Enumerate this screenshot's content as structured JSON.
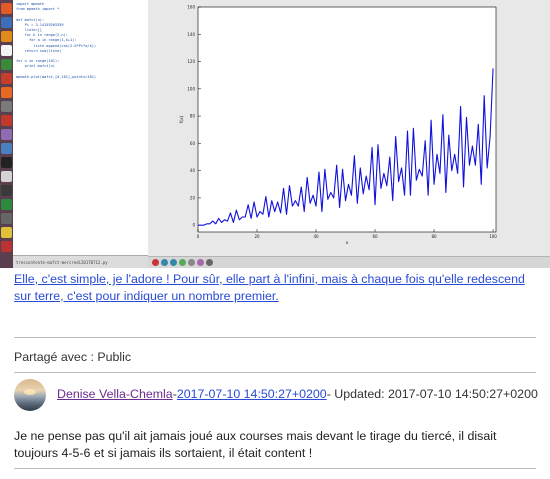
{
  "editor": {
    "code_lines": [
      "import mpmath",
      "from mpmath import *",
      "",
      "def mafct(n):",
      "    Pi = 3.14159265359",
      "    liste=[]",
      "    for k in range(2,n):",
      "      for a in range(1,k+1):",
      "        liste.append(cos(2.0*Pi*a/k))",
      "    return sum(liste)",
      "",
      "for n in range(101):",
      "    print mafct(n)",
      "",
      "mpmath.plot(mafct,[0,101],points=101)"
    ],
    "status_filename": "trescontente-mafct-mercredi20170712.py"
  },
  "plot": {
    "xlabel": "x",
    "ylabel": "f(x)"
  },
  "chart_data": {
    "type": "line",
    "xlim": [
      0,
      101
    ],
    "ylim": [
      -5,
      160
    ],
    "x_ticks": [
      "0",
      "20",
      "40",
      "60",
      "80",
      "100"
    ],
    "y_ticks": [
      "0",
      "20",
      "40",
      "60",
      "80",
      "100",
      "120",
      "140",
      "160"
    ],
    "xlabel": "x",
    "ylabel": "f(x)",
    "series": [
      {
        "color": "#1111dd",
        "x": [
          0,
          1,
          2,
          3,
          4,
          5,
          6,
          7,
          8,
          9,
          10,
          11,
          12,
          13,
          14,
          15,
          16,
          17,
          18,
          19,
          20,
          21,
          22,
          23,
          24,
          25,
          26,
          27,
          28,
          29,
          30,
          31,
          32,
          33,
          34,
          35,
          36,
          37,
          38,
          39,
          40,
          41,
          42,
          43,
          44,
          45,
          46,
          47,
          48,
          49,
          50,
          51,
          52,
          53,
          54,
          55,
          56,
          57,
          58,
          59,
          60,
          61,
          62,
          63,
          64,
          65,
          66,
          67,
          68,
          69,
          70,
          71,
          72,
          73,
          74,
          75,
          76,
          77,
          78,
          79,
          80,
          81,
          82,
          83,
          84,
          85,
          86,
          87,
          88,
          89,
          90,
          91,
          92,
          93,
          94,
          95,
          96,
          97,
          98,
          99,
          100
        ],
        "values": [
          0,
          0,
          0,
          1,
          1,
          3,
          1,
          5,
          2,
          4,
          3,
          9,
          2,
          11,
          4,
          6,
          6,
          15,
          5,
          17,
          6,
          10,
          8,
          21,
          6,
          18,
          10,
          17,
          9,
          27,
          8,
          29,
          14,
          18,
          14,
          28,
          10,
          35,
          16,
          22,
          14,
          39,
          10,
          41,
          19,
          24,
          20,
          44,
          13,
          41,
          18,
          30,
          22,
          51,
          16,
          42,
          23,
          36,
          26,
          57,
          15,
          59,
          27,
          38,
          29,
          50,
          18,
          65,
          32,
          42,
          22,
          69,
          22,
          71,
          33,
          41,
          36,
          62,
          22,
          77,
          30,
          52,
          38,
          81,
          24,
          66,
          40,
          52,
          38,
          87,
          28,
          79,
          44,
          58,
          44,
          74,
          30,
          95,
          42,
          65,
          115
        ]
      }
    ]
  },
  "post": {
    "caption": "Elle, c'est simple, je l'adore ! Pour sûr, elle part à l'infini, mais à chaque fois qu'elle redescend sur terre, c'est pour indiquer un nombre premier.",
    "shared_with": "Partagé avec : Public",
    "author": "Denise Vella-Chemla",
    "sep1": "-",
    "date_link": "2017-07-10 14:50:27+0200",
    "updated": "- Updated: 2017-07-10 14:50:27+0200",
    "comment": "Je ne pense pas qu'il ait jamais joué aux courses mais devant le tirage du tiercé, il disait toujours 4-5-6 et si jamais ils sortaient, il était content !"
  }
}
